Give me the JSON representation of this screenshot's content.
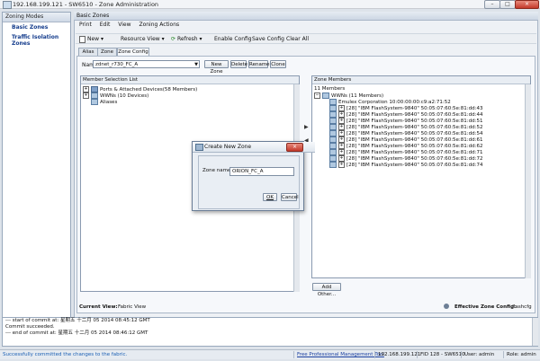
{
  "window": {
    "title": "192.168.199.121 - SW6510 - Zone Administration",
    "minimize": "–",
    "maximize": "□",
    "close": "×"
  },
  "left_panel": {
    "header": "Zoning Modes",
    "items": [
      {
        "label": "Basic Zones"
      },
      {
        "label": "Traffic Isolation Zones"
      }
    ]
  },
  "main_header": "Basic Zones",
  "menu": [
    "Print",
    "Edit",
    "View",
    "Zoning Actions"
  ],
  "toolbar": {
    "new": "New",
    "resource_view": "Resource View",
    "refresh": "Refresh",
    "enable_config": "Enable Config",
    "save_config": "Save Config",
    "clear_all": "Clear All"
  },
  "tabs": [
    "Alias",
    "Zone",
    "Zone Config"
  ],
  "name_row": {
    "label": "Name",
    "selected": "zdnet_r730_FC_A",
    "buttons": [
      "New Zone",
      "Delete",
      "Rename",
      "Clone"
    ]
  },
  "member_selection": {
    "header": "Member Selection List",
    "rows": [
      "Ports & Attached Devices(58 Members)",
      "WWNs (10 Devices)",
      "Aliases"
    ]
  },
  "zone_members": {
    "header": "Zone Members",
    "count": "11 Members",
    "root": "WWNs (11 Members)",
    "rows": [
      "Emulex Corporation 10:00:00:00:c9:a2:71:52",
      "[28] \"IBM     FlashSystem-9840\" 50:05:07:60:5e:81:dd:43",
      "[28] \"IBM     FlashSystem-9840\" 50:05:07:60:5e:81:dd:44",
      "[28] \"IBM     FlashSystem-9840\" 50:05:07:60:5e:81:dd:51",
      "[28] \"IBM     FlashSystem-9840\" 50:05:07:60:5e:81:dd:52",
      "[28] \"IBM     FlashSystem-9840\" 50:05:07:60:5e:81:dd:54",
      "[28] \"IBM     FlashSystem-9840\" 50:05:07:60:5e:81:dd:61",
      "[28] \"IBM     FlashSystem-9840\" 50:05:07:60:5e:81:dd:62",
      "[28] \"IBM     FlashSystem-9840\" 50:05:07:60:5e:81:dd:71",
      "[28] \"IBM     FlashSystem-9840\" 50:05:07:60:5e:81:dd:72",
      "[28] \"IBM     FlashSystem-9840\" 50:05:07:60:5e:81:dd:74"
    ],
    "add_other": "Add Other..."
  },
  "status": {
    "current_view_label": "Current View:",
    "current_view": "Fabric View",
    "effective_label": "Effective Zone Config:",
    "effective_value": "flashcfg"
  },
  "log": [
    "--- start of commit at: 星期五 十二月 05 2014 08:45:12 GMT",
    "Commit succeeded.",
    "--- end of commit at: 星期五 十二月 05 2014 08:46:12 GMT"
  ],
  "bottom": {
    "message": "Successfully committed the changes to the fabric.",
    "tool": "Free Professional Management Tool",
    "ip": "192.168.199.121",
    "fid": "FID 128 - SW6510",
    "user": "User: admin",
    "role": "Role: admin"
  },
  "dialog": {
    "title": "Create New Zone",
    "field_label": "Zone name",
    "field_value": "ORION_FC_A",
    "ok": "OK",
    "cancel": "Cancel"
  },
  "colors": {
    "link_blue": "#143c8c",
    "success_text": "#1a5fb4"
  }
}
